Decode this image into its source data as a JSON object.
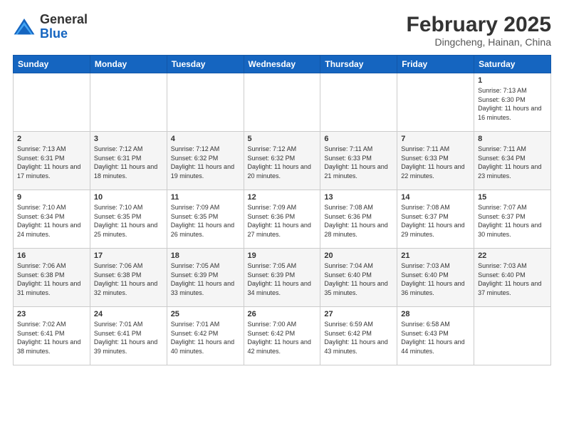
{
  "header": {
    "logo_general": "General",
    "logo_blue": "Blue",
    "month_title": "February 2025",
    "location": "Dingcheng, Hainan, China"
  },
  "days_of_week": [
    "Sunday",
    "Monday",
    "Tuesday",
    "Wednesday",
    "Thursday",
    "Friday",
    "Saturday"
  ],
  "weeks": [
    [
      {
        "day": "",
        "info": ""
      },
      {
        "day": "",
        "info": ""
      },
      {
        "day": "",
        "info": ""
      },
      {
        "day": "",
        "info": ""
      },
      {
        "day": "",
        "info": ""
      },
      {
        "day": "",
        "info": ""
      },
      {
        "day": "1",
        "info": "Sunrise: 7:13 AM\nSunset: 6:30 PM\nDaylight: 11 hours and 16 minutes."
      }
    ],
    [
      {
        "day": "2",
        "info": "Sunrise: 7:13 AM\nSunset: 6:31 PM\nDaylight: 11 hours and 17 minutes."
      },
      {
        "day": "3",
        "info": "Sunrise: 7:12 AM\nSunset: 6:31 PM\nDaylight: 11 hours and 18 minutes."
      },
      {
        "day": "4",
        "info": "Sunrise: 7:12 AM\nSunset: 6:32 PM\nDaylight: 11 hours and 19 minutes."
      },
      {
        "day": "5",
        "info": "Sunrise: 7:12 AM\nSunset: 6:32 PM\nDaylight: 11 hours and 20 minutes."
      },
      {
        "day": "6",
        "info": "Sunrise: 7:11 AM\nSunset: 6:33 PM\nDaylight: 11 hours and 21 minutes."
      },
      {
        "day": "7",
        "info": "Sunrise: 7:11 AM\nSunset: 6:33 PM\nDaylight: 11 hours and 22 minutes."
      },
      {
        "day": "8",
        "info": "Sunrise: 7:11 AM\nSunset: 6:34 PM\nDaylight: 11 hours and 23 minutes."
      }
    ],
    [
      {
        "day": "9",
        "info": "Sunrise: 7:10 AM\nSunset: 6:34 PM\nDaylight: 11 hours and 24 minutes."
      },
      {
        "day": "10",
        "info": "Sunrise: 7:10 AM\nSunset: 6:35 PM\nDaylight: 11 hours and 25 minutes."
      },
      {
        "day": "11",
        "info": "Sunrise: 7:09 AM\nSunset: 6:35 PM\nDaylight: 11 hours and 26 minutes."
      },
      {
        "day": "12",
        "info": "Sunrise: 7:09 AM\nSunset: 6:36 PM\nDaylight: 11 hours and 27 minutes."
      },
      {
        "day": "13",
        "info": "Sunrise: 7:08 AM\nSunset: 6:36 PM\nDaylight: 11 hours and 28 minutes."
      },
      {
        "day": "14",
        "info": "Sunrise: 7:08 AM\nSunset: 6:37 PM\nDaylight: 11 hours and 29 minutes."
      },
      {
        "day": "15",
        "info": "Sunrise: 7:07 AM\nSunset: 6:37 PM\nDaylight: 11 hours and 30 minutes."
      }
    ],
    [
      {
        "day": "16",
        "info": "Sunrise: 7:06 AM\nSunset: 6:38 PM\nDaylight: 11 hours and 31 minutes."
      },
      {
        "day": "17",
        "info": "Sunrise: 7:06 AM\nSunset: 6:38 PM\nDaylight: 11 hours and 32 minutes."
      },
      {
        "day": "18",
        "info": "Sunrise: 7:05 AM\nSunset: 6:39 PM\nDaylight: 11 hours and 33 minutes."
      },
      {
        "day": "19",
        "info": "Sunrise: 7:05 AM\nSunset: 6:39 PM\nDaylight: 11 hours and 34 minutes."
      },
      {
        "day": "20",
        "info": "Sunrise: 7:04 AM\nSunset: 6:40 PM\nDaylight: 11 hours and 35 minutes."
      },
      {
        "day": "21",
        "info": "Sunrise: 7:03 AM\nSunset: 6:40 PM\nDaylight: 11 hours and 36 minutes."
      },
      {
        "day": "22",
        "info": "Sunrise: 7:03 AM\nSunset: 6:40 PM\nDaylight: 11 hours and 37 minutes."
      }
    ],
    [
      {
        "day": "23",
        "info": "Sunrise: 7:02 AM\nSunset: 6:41 PM\nDaylight: 11 hours and 38 minutes."
      },
      {
        "day": "24",
        "info": "Sunrise: 7:01 AM\nSunset: 6:41 PM\nDaylight: 11 hours and 39 minutes."
      },
      {
        "day": "25",
        "info": "Sunrise: 7:01 AM\nSunset: 6:42 PM\nDaylight: 11 hours and 40 minutes."
      },
      {
        "day": "26",
        "info": "Sunrise: 7:00 AM\nSunset: 6:42 PM\nDaylight: 11 hours and 42 minutes."
      },
      {
        "day": "27",
        "info": "Sunrise: 6:59 AM\nSunset: 6:42 PM\nDaylight: 11 hours and 43 minutes."
      },
      {
        "day": "28",
        "info": "Sunrise: 6:58 AM\nSunset: 6:43 PM\nDaylight: 11 hours and 44 minutes."
      },
      {
        "day": "",
        "info": ""
      }
    ]
  ]
}
